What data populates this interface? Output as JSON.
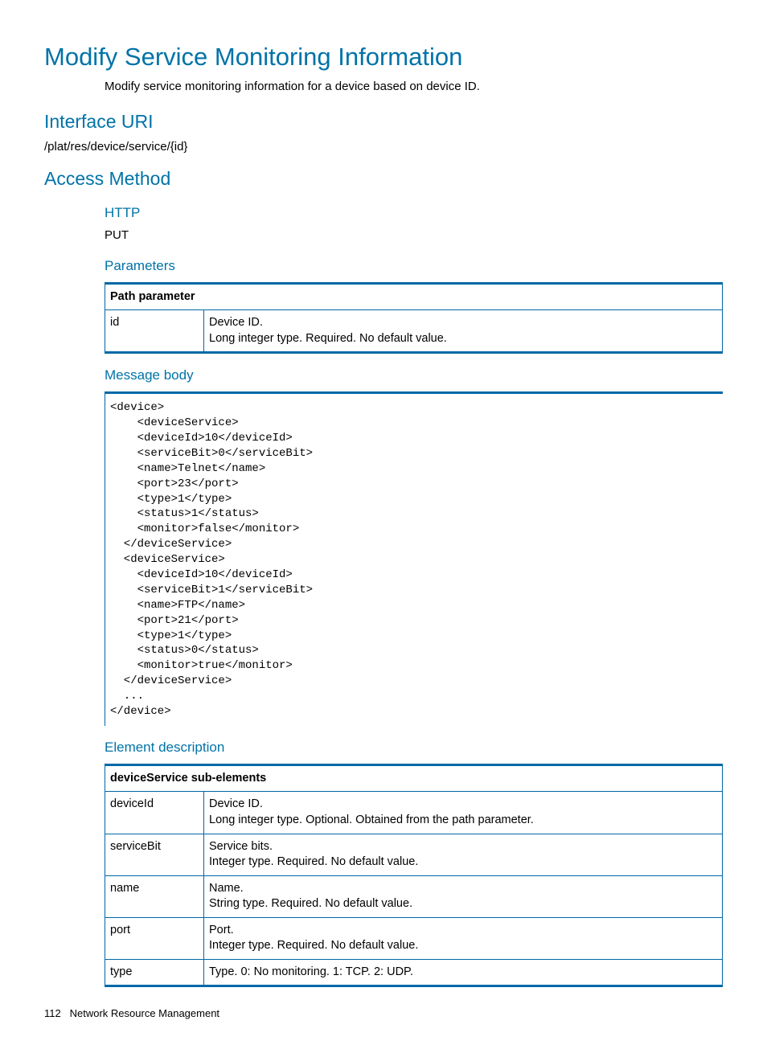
{
  "title": "Modify Service Monitoring Information",
  "intro": "Modify service monitoring information for a device based on device ID.",
  "uri_heading": "Interface URI",
  "uri_value": "/plat/res/device/service/{id}",
  "access_heading": "Access Method",
  "http_heading": "HTTP",
  "http_method": "PUT",
  "parameters_heading": "Parameters",
  "path_param_header": "Path parameter",
  "path_param": {
    "name": "id",
    "line1": "Device ID.",
    "line2": "Long integer type. Required. No default value."
  },
  "msgbody_heading": "Message body",
  "msgbody_code": "<device>\n    <deviceService>\n    <deviceId>10</deviceId>\n    <serviceBit>0</serviceBit>\n    <name>Telnet</name>\n    <port>23</port>\n    <type>1</type>\n    <status>1</status>\n    <monitor>false</monitor>\n  </deviceService>\n  <deviceService>\n    <deviceId>10</deviceId>\n    <serviceBit>1</serviceBit>\n    <name>FTP</name>\n    <port>21</port>\n    <type>1</type>\n    <status>0</status>\n    <monitor>true</monitor>\n  </deviceService>\n  ...\n</device>",
  "elemdesc_heading": "Element description",
  "sub_elem_header": "deviceService sub-elements",
  "rows": [
    {
      "name": "deviceId",
      "line1": "Device ID.",
      "line2": "Long integer type. Optional. Obtained from the path parameter."
    },
    {
      "name": "serviceBit",
      "line1": "Service bits.",
      "line2": "Integer type. Required. No default value."
    },
    {
      "name": "name",
      "line1": "Name.",
      "line2": "String type. Required. No default value."
    },
    {
      "name": "port",
      "line1": "Port.",
      "line2": "Integer type. Required. No default value."
    },
    {
      "name": "type",
      "line1": "Type. 0: No monitoring. 1: TCP. 2: UDP.",
      "line2": ""
    }
  ],
  "footer": {
    "page": "112",
    "chapter": "Network Resource Management"
  }
}
